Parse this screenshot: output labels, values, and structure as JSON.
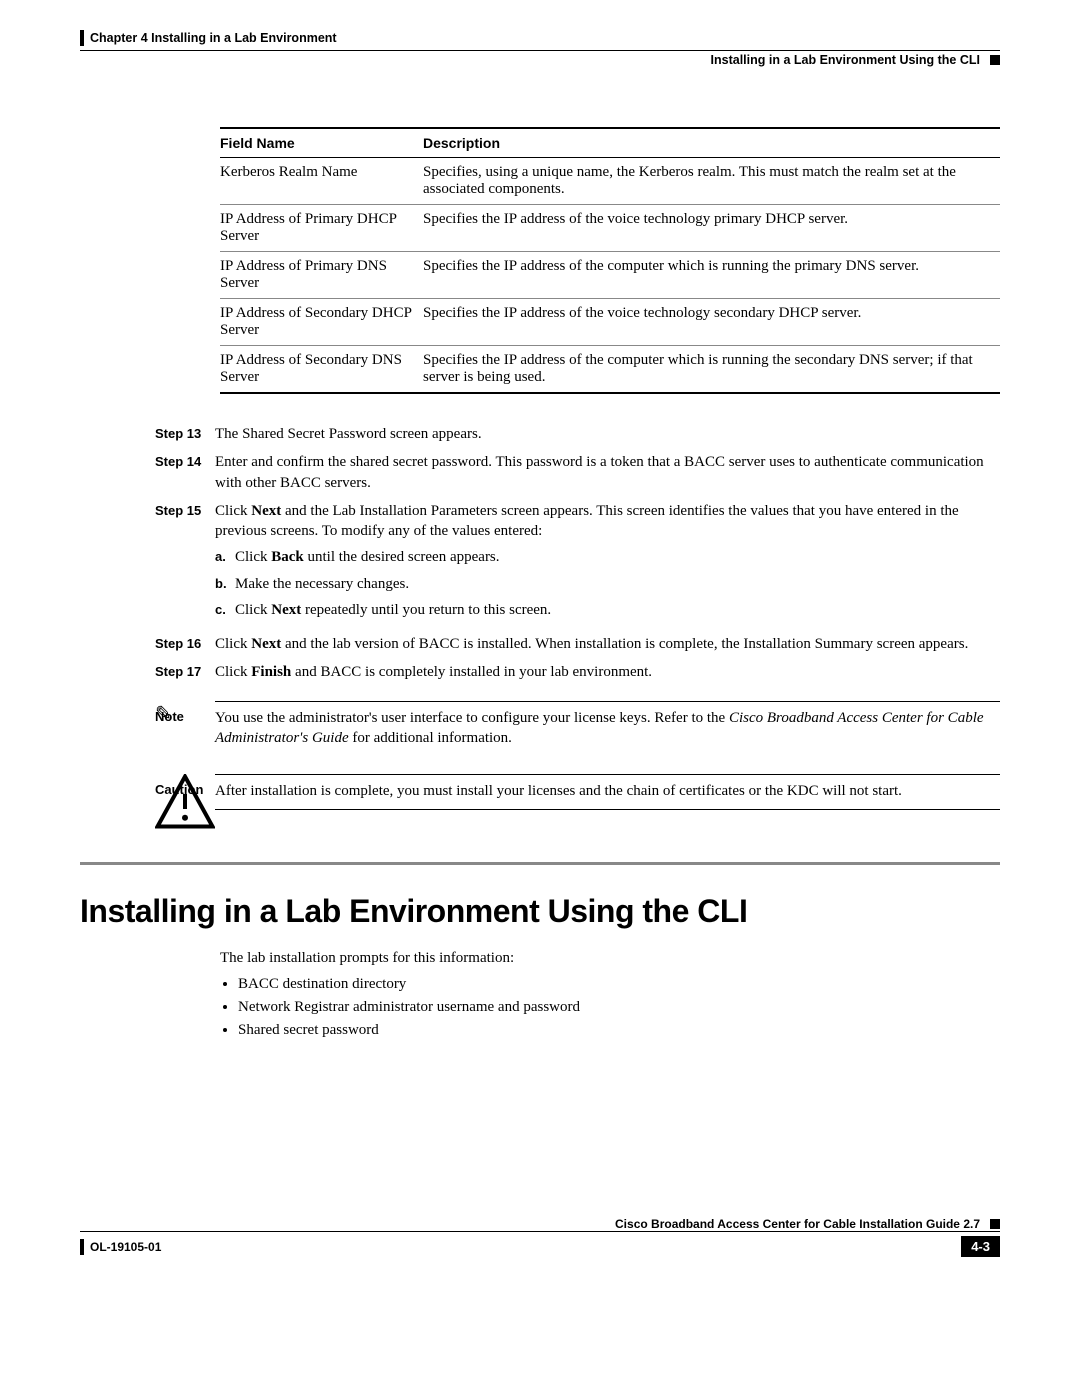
{
  "header": {
    "chapter": "Chapter 4    Installing in a Lab Environment",
    "section": "Installing in a Lab Environment Using the CLI"
  },
  "table": {
    "headers": {
      "field": "Field Name",
      "desc": "Description"
    },
    "rows": [
      {
        "field": "Kerberos Realm Name",
        "desc": "Specifies, using a unique name, the Kerberos realm. This must match the realm set at the associated components."
      },
      {
        "field": "IP Address of Primary DHCP Server",
        "desc": "Specifies the IP address of the voice technology primary DHCP server."
      },
      {
        "field": "IP Address of Primary DNS Server",
        "desc": "Specifies the IP address of the computer which is running the primary DNS server."
      },
      {
        "field": "IP Address of Secondary DHCP Server",
        "desc": "Specifies the IP address of the voice technology secondary DHCP server."
      },
      {
        "field": "IP Address of Secondary DNS Server",
        "desc": "Specifies the IP address of the computer which is running the secondary DNS server; if that server is being used."
      }
    ]
  },
  "steps": {
    "s13": {
      "label": "Step 13",
      "text": "The Shared Secret Password screen appears."
    },
    "s14": {
      "label": "Step 14",
      "text": "Enter and confirm the shared secret password. This password is a token that a BACC server uses to authenticate communication with other BACC servers."
    },
    "s15": {
      "label": "Step 15",
      "pre": "Click ",
      "bold1": "Next",
      "post": " and the Lab Installation Parameters screen appears. This screen identifies the values that you have entered in the previous screens. To modify any of the values entered:",
      "a_m": "a.",
      "a_pre": "Click ",
      "a_b": "Back",
      "a_post": " until the desired screen appears.",
      "b_m": "b.",
      "b": "Make the necessary changes.",
      "c_m": "c.",
      "c_pre": "Click ",
      "c_b": "Next",
      "c_post": " repeatedly until you return to this screen."
    },
    "s16": {
      "label": "Step 16",
      "pre": "Click ",
      "bold1": "Next",
      "post": " and the lab version of BACC is installed. When installation is complete, the Installation Summary screen appears."
    },
    "s17": {
      "label": "Step 17",
      "pre": "Click ",
      "bold1": "Finish",
      "post": " and BACC is completely installed in your lab environment."
    }
  },
  "note": {
    "label": "Note",
    "pre": "You use the administrator's user interface to configure your license keys. Refer to the ",
    "italic": "Cisco Broadband Access Center for Cable Administrator's Guide",
    "post": " for additional information."
  },
  "caution": {
    "label": "Caution",
    "text": "After installation is complete, you must install your licenses and the chain of certificates or the KDC will not start."
  },
  "section": {
    "title": "Installing in a Lab Environment Using the CLI",
    "intro": "The lab installation prompts for this information:",
    "bullets": [
      "BACC destination directory",
      "Network Registrar administrator username and password",
      "Shared secret password"
    ]
  },
  "footer": {
    "guide": "Cisco Broadband Access Center for Cable Installation Guide 2.7",
    "doc": "OL-19105-01",
    "page": "4-3"
  }
}
